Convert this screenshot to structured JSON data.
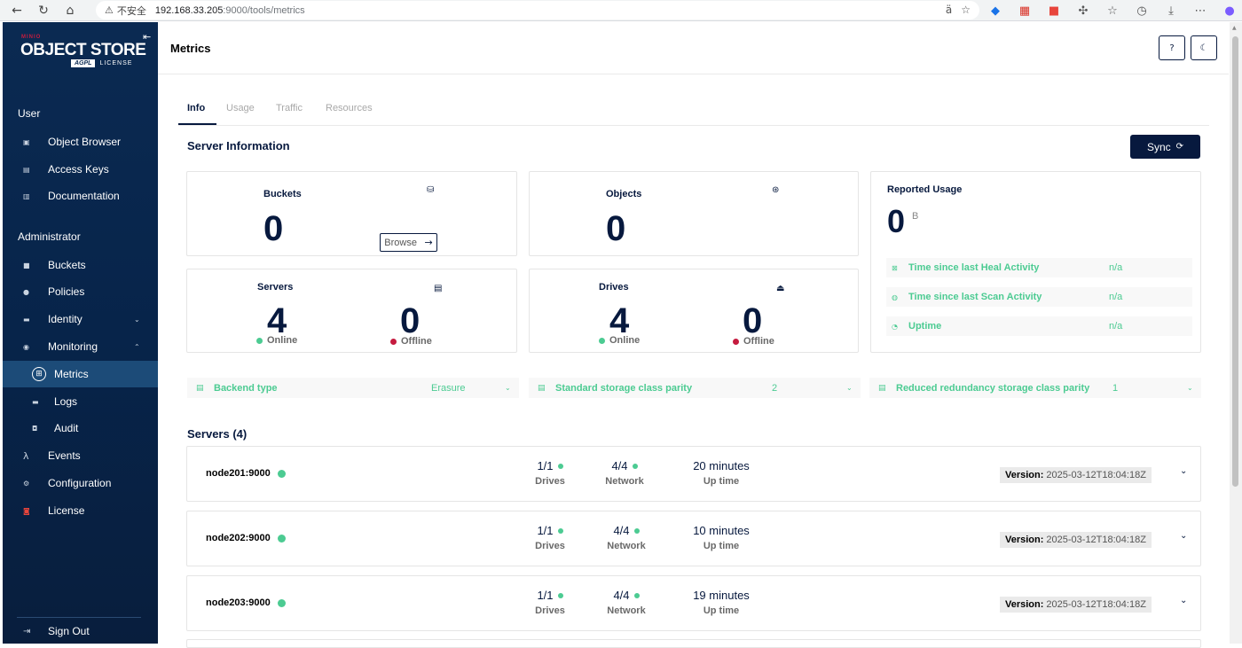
{
  "browser": {
    "insecure": "不安全",
    "host": "192.168.33.205",
    "path": ":9000/tools/metrics",
    "translate_glyph": "ä",
    "star_glyph": "☆"
  },
  "sidebar": {
    "logo_minio": "MINIO",
    "logo_main": "OBJECT STORE",
    "logo_agpl": "AGPL",
    "logo_license": "LICENSE",
    "user_section": "User",
    "user_items": [
      {
        "label": "Object Browser",
        "icon": "object-browser-icon"
      },
      {
        "label": "Access Keys",
        "icon": "access-keys-icon"
      },
      {
        "label": "Documentation",
        "icon": "documentation-icon"
      }
    ],
    "admin_section": "Administrator",
    "admin_items": [
      {
        "label": "Buckets",
        "icon": "buckets-icon"
      },
      {
        "label": "Policies",
        "icon": "policies-icon"
      },
      {
        "label": "Identity",
        "icon": "identity-icon"
      },
      {
        "label": "Monitoring",
        "icon": "monitoring-icon"
      },
      {
        "label": "Metrics",
        "icon": "metrics-icon"
      },
      {
        "label": "Logs",
        "icon": "logs-icon"
      },
      {
        "label": "Audit",
        "icon": "audit-icon"
      },
      {
        "label": "Events",
        "icon": "events-icon"
      },
      {
        "label": "Configuration",
        "icon": "configuration-icon"
      },
      {
        "label": "License",
        "icon": "license-icon"
      }
    ],
    "sign_out": "Sign Out"
  },
  "header": {
    "title": "Metrics"
  },
  "tabs": [
    "Info",
    "Usage",
    "Traffic",
    "Resources"
  ],
  "server_information": {
    "heading": "Server Information",
    "sync_label": "Sync",
    "buckets": {
      "title": "Buckets",
      "value": "0",
      "browse_label": "Browse"
    },
    "objects": {
      "title": "Objects",
      "value": "0"
    },
    "reported_usage": {
      "title": "Reported Usage",
      "value": "0",
      "unit": "B",
      "rows": [
        {
          "label": "Time since last Heal Activity",
          "value": "n/a"
        },
        {
          "label": "Time since last Scan Activity",
          "value": "n/a"
        },
        {
          "label": "Uptime",
          "value": "n/a"
        }
      ]
    },
    "servers": {
      "title": "Servers",
      "online": "4",
      "offline": "0",
      "online_label": "Online",
      "offline_label": "Offline"
    },
    "drives": {
      "title": "Drives",
      "online": "4",
      "offline": "0",
      "online_label": "Online",
      "offline_label": "Offline"
    },
    "backend_type": {
      "label": "Backend type",
      "value": "Erasure"
    },
    "standard_parity": {
      "label": "Standard storage class parity",
      "value": "2"
    },
    "reduced_parity": {
      "label": "Reduced redundancy storage class parity",
      "value": "1"
    }
  },
  "servers_section": {
    "heading": "Servers (4)",
    "drives_label": "Drives",
    "network_label": "Network",
    "uptime_label": "Up time",
    "version_label": "Version:",
    "servers": [
      {
        "name": "node201:9000",
        "drives": "1/1",
        "network": "4/4",
        "uptime": "20 minutes",
        "version": "2025-03-12T18:04:18Z"
      },
      {
        "name": "node202:9000",
        "drives": "1/1",
        "network": "4/4",
        "uptime": "10 minutes",
        "version": "2025-03-12T18:04:18Z"
      },
      {
        "name": "node203:9000",
        "drives": "1/1",
        "network": "4/4",
        "uptime": "19 minutes",
        "version": "2025-03-12T18:04:18Z"
      }
    ]
  },
  "colors": {
    "navy": "#07193E",
    "online_green": "#4CCB92",
    "offline_red": "#C51B3F",
    "sidebar_bg": "#0B2A52",
    "active_item": "#1C4B78"
  }
}
